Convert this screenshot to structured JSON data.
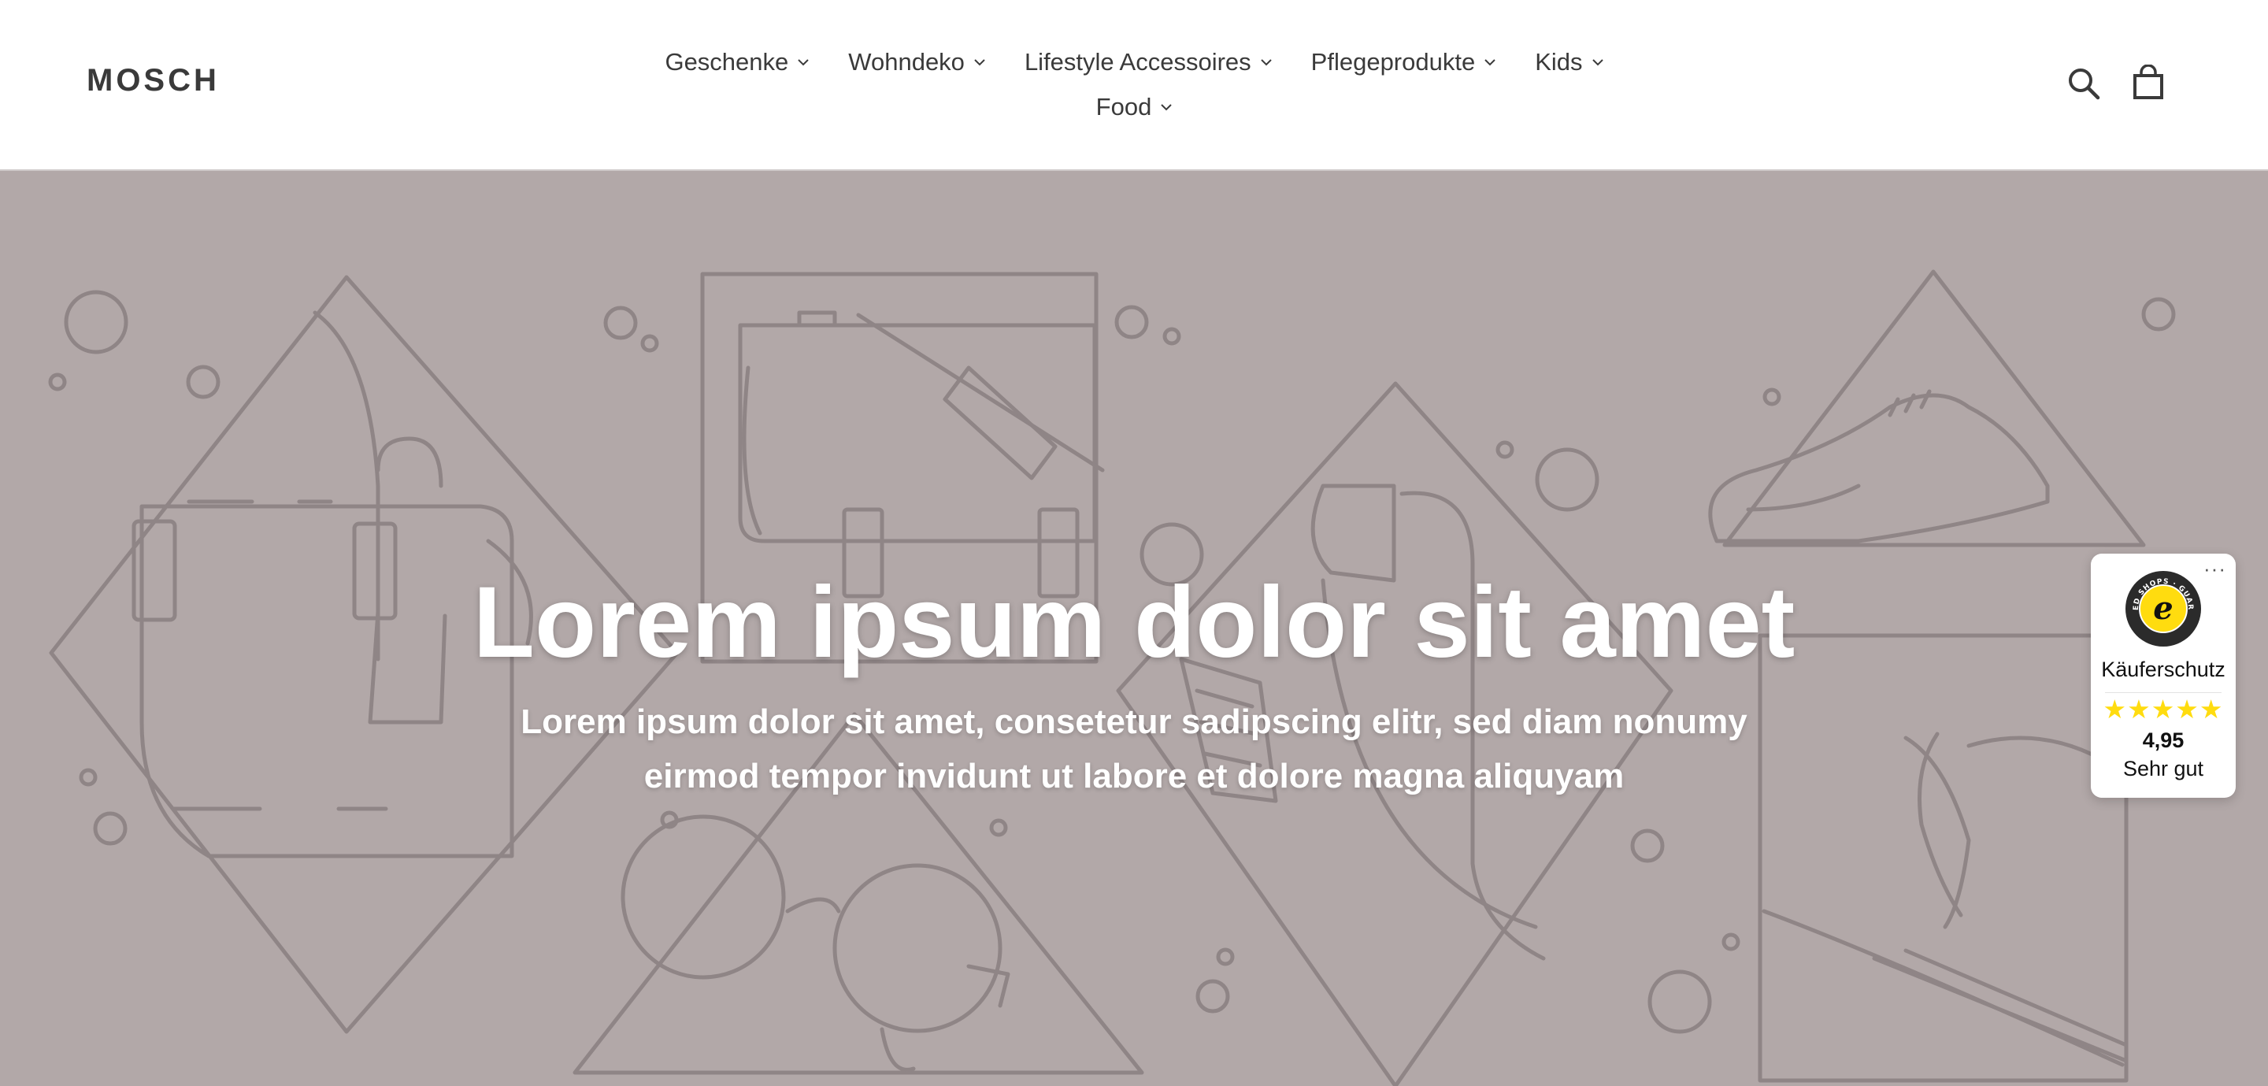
{
  "brand": {
    "logo": "MOSCH"
  },
  "nav": {
    "row1": [
      {
        "label": "Geschenke"
      },
      {
        "label": "Wohndeko"
      },
      {
        "label": "Lifestyle Accessoires"
      },
      {
        "label": "Pflegeprodukte"
      },
      {
        "label": "Kids"
      }
    ],
    "row2": [
      {
        "label": "Food"
      }
    ]
  },
  "header_icons": {
    "search": "search-icon",
    "cart": "cart-icon"
  },
  "hero": {
    "title": "Lorem ipsum dolor sit amet",
    "subtitle_line1": "Lorem ipsum dolor sit amet, consetetur sadipscing elitr, sed diam nonumy",
    "subtitle_line2": "eirmod tempor invidunt ut labore et dolore magna aliquyam",
    "background_color": "#b2a8a8",
    "line_color": "#8f8586"
  },
  "trust_badge": {
    "menu": "···",
    "seal_text": "TRUSTED SHOPS · GUARANTEE",
    "seal_letter": "e",
    "label": "Käuferschutz",
    "stars": "★★★★★",
    "stars_value": 5,
    "score": "4,95",
    "rating_text": "Sehr gut",
    "star_color": "#ffdc0f"
  }
}
